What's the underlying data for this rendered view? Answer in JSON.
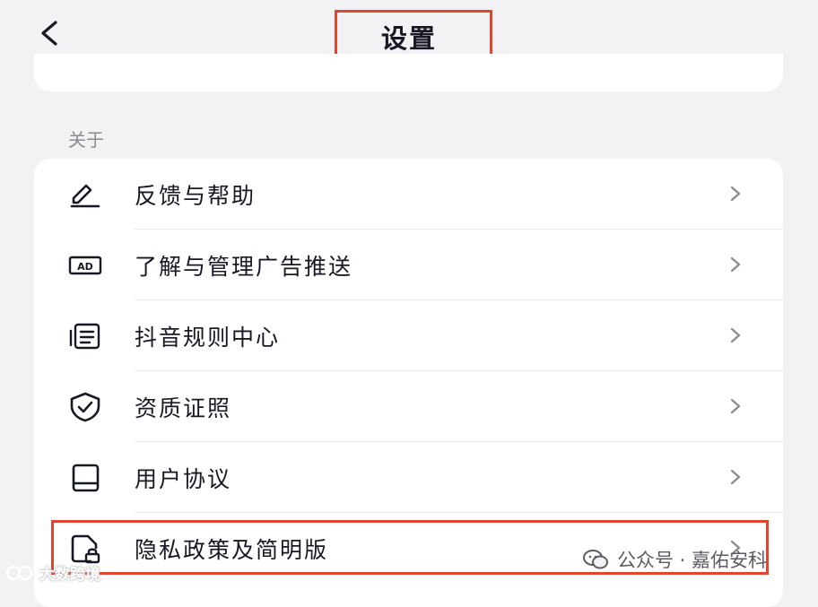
{
  "header": {
    "title": "设置",
    "back_icon": "chevron-left-icon"
  },
  "section": {
    "label": "关于"
  },
  "menu": {
    "items": [
      {
        "label": "反馈与帮助",
        "icon": "edit-pen-icon"
      },
      {
        "label": "了解与管理广告推送",
        "icon": "ad-icon"
      },
      {
        "label": "抖音规则中心",
        "icon": "rules-document-icon"
      },
      {
        "label": "资质证照",
        "icon": "shield-check-icon"
      },
      {
        "label": "用户协议",
        "icon": "book-icon"
      },
      {
        "label": "隐私政策及简明版",
        "icon": "file-lock-icon"
      }
    ]
  },
  "watermark": {
    "text": "公众号 · 嘉佑安科",
    "text2": "大数跨境"
  },
  "colors": {
    "highlight": "#e0452f",
    "background": "#f2f2f4",
    "text": "#161823"
  }
}
